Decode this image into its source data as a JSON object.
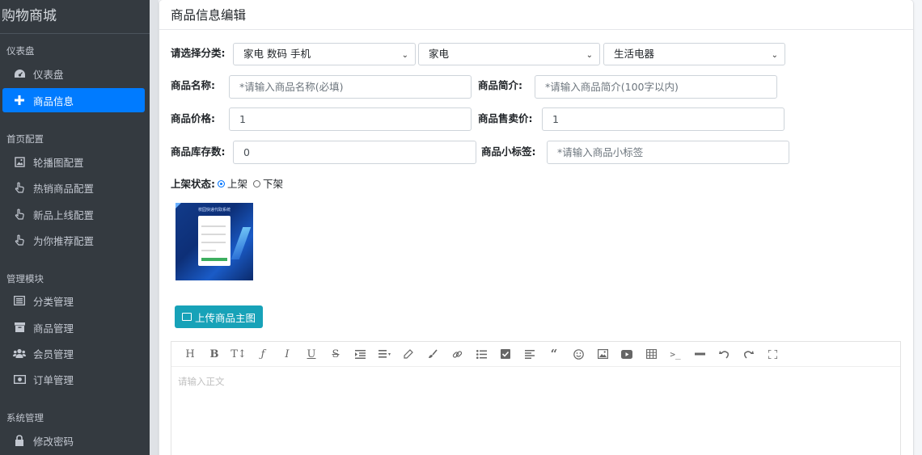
{
  "sidebar": {
    "brand": "购物商城",
    "sections": [
      "仪表盘",
      "首页配置",
      "管理模块",
      "系统管理"
    ],
    "items": [
      {
        "label": "仪表盘",
        "icon": "dashboard-icon"
      },
      {
        "label": "商品信息",
        "icon": "plus-icon",
        "active": true
      },
      {
        "label": "轮播图配置",
        "icon": "image-icon"
      },
      {
        "label": "热销商品配置",
        "icon": "hand-pointer-icon"
      },
      {
        "label": "新品上线配置",
        "icon": "hand-pointer-icon"
      },
      {
        "label": "为你推荐配置",
        "icon": "hand-pointer-icon"
      },
      {
        "label": "分类管理",
        "icon": "list-icon"
      },
      {
        "label": "商品管理",
        "icon": "archive-icon"
      },
      {
        "label": "会员管理",
        "icon": "users-icon"
      },
      {
        "label": "订单管理",
        "icon": "money-icon"
      },
      {
        "label": "修改密码",
        "icon": "lock-icon"
      }
    ]
  },
  "card": {
    "title": "商品信息编辑"
  },
  "form": {
    "category_label": "请选择分类:",
    "category1": "家电 数码 手机",
    "category2": "家电",
    "category3": "生活电器",
    "name_label": "商品名称:",
    "name_placeholder": "*请输入商品名称(必填)",
    "intro_label": "商品简介:",
    "intro_placeholder": "*请输入商品简介(100字以内)",
    "price_label": "商品价格:",
    "price_value": "1",
    "sell_price_label": "商品售卖价:",
    "sell_price_value": "1",
    "stock_label": "商品库存数:",
    "stock_value": "0",
    "tag_label": "商品小标签:",
    "tag_placeholder": "*请输入商品小标签",
    "status_label": "上架状态:",
    "status_on": "上架",
    "status_off": "下架",
    "upload_label": "上传商品主图",
    "thumb_title": "校园快递代取系统"
  },
  "editor": {
    "placeholder": "请输入正文",
    "toolbar": [
      "heading-icon",
      "bold-icon",
      "font-size-icon",
      "font-family-icon",
      "italic-icon",
      "underline-icon",
      "strikethrough-icon",
      "indent-icon",
      "line-height-icon",
      "foreground-color-icon",
      "background-color-icon",
      "link-icon",
      "bullet-list-icon",
      "todo-icon",
      "justify-icon",
      "quote-icon",
      "emoji-icon",
      "image-icon",
      "video-icon",
      "table-icon",
      "code-icon",
      "divider-icon",
      "undo-icon",
      "redo-icon",
      "fullscreen-icon"
    ]
  },
  "colors": {
    "sidebar_bg": "#343a40",
    "active": "#007bff",
    "upload_btn": "#17a2b8"
  }
}
